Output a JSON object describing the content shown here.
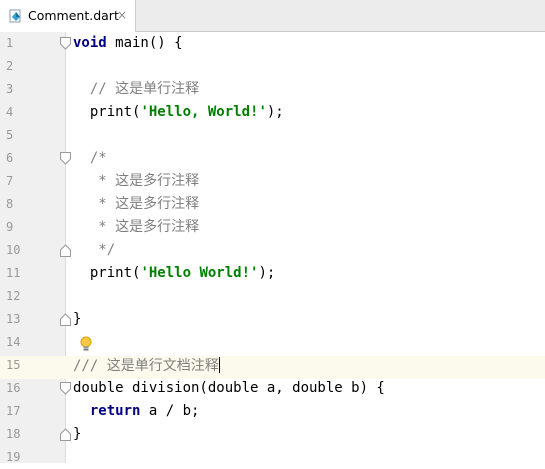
{
  "tab": {
    "title": "Comment.dart",
    "close_glyph": "×",
    "icon": "dart-file-icon"
  },
  "editor": {
    "lines": [
      {
        "num": "1",
        "parts": [
          {
            "t": "void",
            "k": "kw"
          },
          {
            "t": " main() {",
            "k": ""
          }
        ]
      },
      {
        "num": "2",
        "parts": []
      },
      {
        "num": "3",
        "parts": [
          {
            "t": "  // 这是单行注释",
            "k": "cmt"
          }
        ]
      },
      {
        "num": "4",
        "parts": [
          {
            "t": "  print(",
            "k": ""
          },
          {
            "t": "'Hello, World!'",
            "k": "str"
          },
          {
            "t": ");",
            "k": ""
          }
        ]
      },
      {
        "num": "5",
        "parts": []
      },
      {
        "num": "6",
        "parts": [
          {
            "t": "  /*",
            "k": "cmt"
          }
        ]
      },
      {
        "num": "7",
        "parts": [
          {
            "t": "   * 这是多行注释",
            "k": "cmt"
          }
        ]
      },
      {
        "num": "8",
        "parts": [
          {
            "t": "   * 这是多行注释",
            "k": "cmt"
          }
        ]
      },
      {
        "num": "9",
        "parts": [
          {
            "t": "   * 这是多行注释",
            "k": "cmt"
          }
        ]
      },
      {
        "num": "10",
        "parts": [
          {
            "t": "   */",
            "k": "cmt"
          }
        ]
      },
      {
        "num": "11",
        "parts": [
          {
            "t": "  print(",
            "k": ""
          },
          {
            "t": "'Hello World!'",
            "k": "str"
          },
          {
            "t": ");",
            "k": ""
          }
        ]
      },
      {
        "num": "12",
        "parts": []
      },
      {
        "num": "13",
        "parts": [
          {
            "t": "}",
            "k": ""
          }
        ]
      },
      {
        "num": "14",
        "parts": []
      },
      {
        "num": "15",
        "parts": [
          {
            "t": "/// 这是单行文档注释",
            "k": "cmt"
          }
        ]
      },
      {
        "num": "16",
        "parts": [
          {
            "t": "double division(double a, double b) {",
            "k": ""
          }
        ]
      },
      {
        "num": "17",
        "parts": [
          {
            "t": "  ",
            "k": ""
          },
          {
            "t": "return",
            "k": "kw"
          },
          {
            "t": " a / b;",
            "k": ""
          }
        ]
      },
      {
        "num": "18",
        "parts": [
          {
            "t": "}",
            "k": ""
          }
        ]
      },
      {
        "num": "19",
        "parts": []
      }
    ],
    "fold_markers": {
      "1": "fold-open-icon",
      "6": "fold-open-icon",
      "10": "fold-close-icon",
      "13": "fold-close-icon",
      "16": "fold-open-icon",
      "18": "fold-close-icon"
    },
    "cursor_line": "15",
    "intention_bulb_line": "14",
    "colors": {
      "keyword": "#000080",
      "string": "#008000",
      "comment": "#808080",
      "caret_row": "#fcfaed",
      "gutter": "#f0f0f0"
    }
  }
}
